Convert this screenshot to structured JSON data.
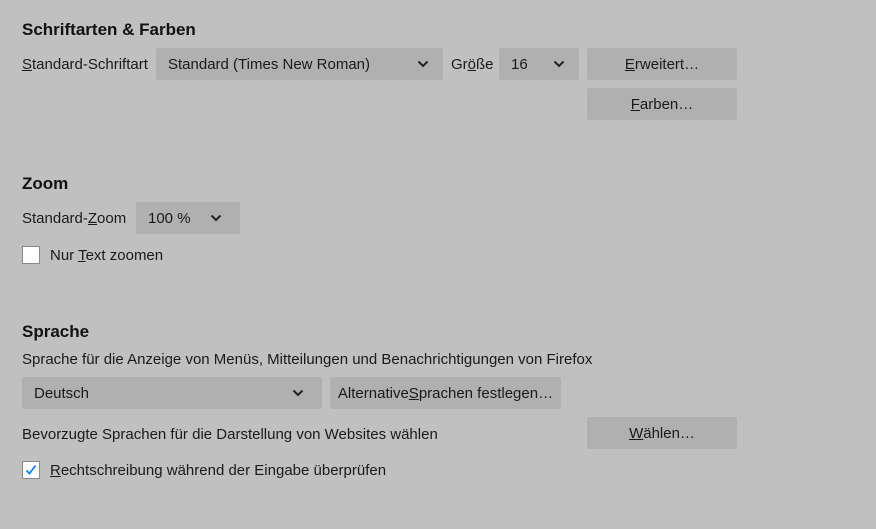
{
  "fonts": {
    "heading": "Schriftarten & Farben",
    "default_font_label_u": "S",
    "default_font_label_rest": "tandard-Schriftart",
    "default_font_value": "Standard (Times New Roman)",
    "size_label_pre": "Gr",
    "size_label_u": "ö",
    "size_label_post": "ße",
    "size_value": "16",
    "advanced_button_u": "E",
    "advanced_button_rest": "rweitert…",
    "colors_button_u": "F",
    "colors_button_rest": "arben…"
  },
  "zoom": {
    "heading": "Zoom",
    "default_zoom_label_pre": "Standard-",
    "default_zoom_label_u": "Z",
    "default_zoom_label_post": "oom",
    "default_zoom_value": "100 %",
    "text_only_label_pre": "Nur ",
    "text_only_label_u": "T",
    "text_only_label_post": "ext zoomen",
    "text_only_checked": false
  },
  "language": {
    "heading": "Sprache",
    "ui_language_desc": "Sprache für die Anzeige von Menüs, Mitteilungen und Benachrichtigungen von Firefox",
    "ui_language_value": "Deutsch",
    "alt_languages_button_pre": "Alternative ",
    "alt_languages_button_u": "S",
    "alt_languages_button_post": "prachen festlegen…",
    "web_languages_desc": "Bevorzugte Sprachen für die Darstellung von Websites wählen",
    "choose_button_u": "W",
    "choose_button_rest": "ählen…",
    "spellcheck_label_u": "R",
    "spellcheck_label_rest": "echtschreibung während der Eingabe überprüfen",
    "spellcheck_checked": true
  },
  "icons": {
    "dropdown": "chevron-down-icon",
    "check": "check-icon"
  },
  "colors": {
    "background": "#c0c0c0",
    "control": "#b0b0b0",
    "check": "#0a84ff"
  }
}
